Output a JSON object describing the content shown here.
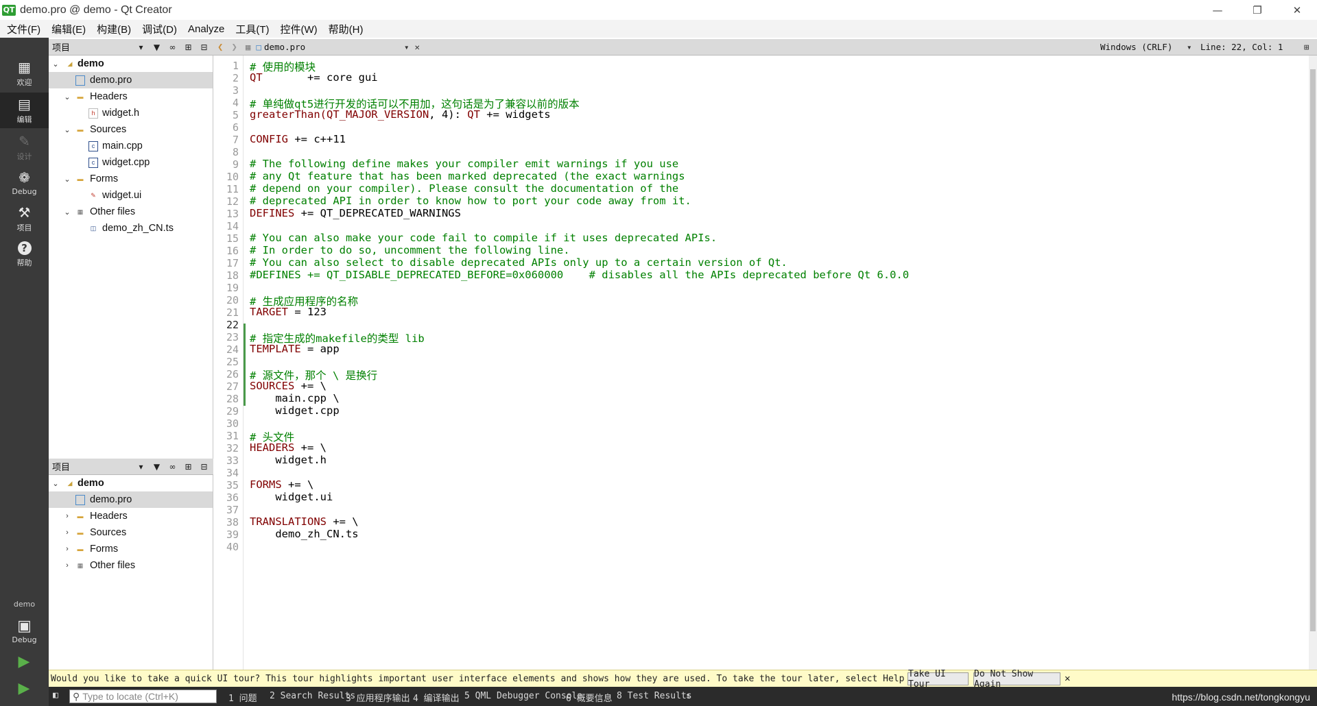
{
  "window": {
    "title": "demo.pro @ demo - Qt Creator",
    "logo": "QT"
  },
  "menu": [
    "文件(F)",
    "编辑(E)",
    "构建(B)",
    "调试(D)",
    "Analyze",
    "工具(T)",
    "控件(W)",
    "帮助(H)"
  ],
  "modes": [
    {
      "label": "欢迎",
      "icon": "grid-icon"
    },
    {
      "label": "编辑",
      "icon": "edit-icon"
    },
    {
      "label": "设计",
      "icon": "pencil-icon"
    },
    {
      "label": "Debug",
      "icon": "bug-icon"
    },
    {
      "label": "项目",
      "icon": "wrench-icon"
    },
    {
      "label": "帮助",
      "icon": "help-icon"
    }
  ],
  "kit": {
    "project": "demo",
    "mode": "Debug"
  },
  "projects_pane": {
    "title": "项目",
    "tree": [
      {
        "label": "demo",
        "level": 0,
        "expanded": true,
        "bold": true
      },
      {
        "label": "demo.pro",
        "level": 1,
        "selected": true
      },
      {
        "label": "Headers",
        "level": 1,
        "expanded": true
      },
      {
        "label": "widget.h",
        "level": 2
      },
      {
        "label": "Sources",
        "level": 1,
        "expanded": true
      },
      {
        "label": "main.cpp",
        "level": 2
      },
      {
        "label": "widget.cpp",
        "level": 2
      },
      {
        "label": "Forms",
        "level": 1,
        "expanded": true
      },
      {
        "label": "widget.ui",
        "level": 2
      },
      {
        "label": "Other files",
        "level": 1,
        "expanded": true
      },
      {
        "label": "demo_zh_CN.ts",
        "level": 2
      }
    ]
  },
  "projects_pane2": {
    "title": "项目",
    "tree": [
      {
        "label": "demo",
        "level": 0,
        "expanded": true,
        "bold": true
      },
      {
        "label": "demo.pro",
        "level": 1,
        "selected": true
      },
      {
        "label": "Headers",
        "level": 1,
        "expanded": false
      },
      {
        "label": "Sources",
        "level": 1,
        "expanded": false
      },
      {
        "label": "Forms",
        "level": 1,
        "expanded": false
      },
      {
        "label": "Other files",
        "level": 1,
        "expanded": false
      }
    ]
  },
  "editor": {
    "file": "demo.pro",
    "line_ending": "Windows (CRLF)",
    "position": "Line: 22, Col: 1",
    "current_line": 22,
    "colors": {
      "comment": "#008000",
      "keyword": "#800000",
      "text": "#000000"
    },
    "lines": [
      [
        {
          "t": "# 使用的模块",
          "c": "comment"
        }
      ],
      [
        {
          "t": "QT",
          "c": "keyword"
        },
        {
          "t": "       += core gui",
          "c": "text"
        }
      ],
      [],
      [
        {
          "t": "# 单纯做qt5进行开发的话可以不用加，这句话是为了兼容以前的版本",
          "c": "comment"
        }
      ],
      [
        {
          "t": "greaterThan(QT_MAJOR_VERSION",
          "c": "keyword"
        },
        {
          "t": ", 4): ",
          "c": "text"
        },
        {
          "t": "QT",
          "c": "keyword"
        },
        {
          "t": " += widgets",
          "c": "text"
        }
      ],
      [],
      [
        {
          "t": "CONFIG",
          "c": "keyword"
        },
        {
          "t": " += c++11",
          "c": "text"
        }
      ],
      [],
      [
        {
          "t": "# The following define makes your compiler emit warnings if you use",
          "c": "comment"
        }
      ],
      [
        {
          "t": "# any Qt feature that has been marked deprecated (the exact warnings",
          "c": "comment"
        }
      ],
      [
        {
          "t": "# depend on your compiler). Please consult the documentation of the",
          "c": "comment"
        }
      ],
      [
        {
          "t": "# deprecated API in order to know how to port your code away from it.",
          "c": "comment"
        }
      ],
      [
        {
          "t": "DEFINES",
          "c": "keyword"
        },
        {
          "t": " += QT_DEPRECATED_WARNINGS",
          "c": "text"
        }
      ],
      [],
      [
        {
          "t": "# You can also make your code fail to compile if it uses deprecated APIs.",
          "c": "comment"
        }
      ],
      [
        {
          "t": "# In order to do so, uncomment the following line.",
          "c": "comment"
        }
      ],
      [
        {
          "t": "# You can also select to disable deprecated APIs only up to a certain version of Qt.",
          "c": "comment"
        }
      ],
      [
        {
          "t": "#DEFINES += QT_DISABLE_DEPRECATED_BEFORE=0x060000    # disables all the APIs deprecated before Qt 6.0.0",
          "c": "comment"
        }
      ],
      [],
      [
        {
          "t": "# 生成应用程序的名称",
          "c": "comment"
        }
      ],
      [
        {
          "t": "TARGET",
          "c": "keyword"
        },
        {
          "t": " = 123",
          "c": "text"
        }
      ],
      [],
      [
        {
          "t": "# 指定生成的makefile的类型 lib",
          "c": "comment"
        }
      ],
      [
        {
          "t": "TEMPLATE",
          "c": "keyword"
        },
        {
          "t": " = app",
          "c": "text"
        }
      ],
      [],
      [
        {
          "t": "# 源文件，那个 \\ 是换行",
          "c": "comment"
        }
      ],
      [
        {
          "t": "SOURCES",
          "c": "keyword"
        },
        {
          "t": " += \\",
          "c": "text"
        }
      ],
      [
        {
          "t": "    main.cpp \\",
          "c": "text"
        }
      ],
      [
        {
          "t": "    widget.cpp",
          "c": "text"
        }
      ],
      [],
      [
        {
          "t": "# 头文件",
          "c": "comment"
        }
      ],
      [
        {
          "t": "HEADERS",
          "c": "keyword"
        },
        {
          "t": " += \\",
          "c": "text"
        }
      ],
      [
        {
          "t": "    widget.h",
          "c": "text"
        }
      ],
      [],
      [
        {
          "t": "FORMS",
          "c": "keyword"
        },
        {
          "t": " += \\",
          "c": "text"
        }
      ],
      [
        {
          "t": "    widget.ui",
          "c": "text"
        }
      ],
      [],
      [
        {
          "t": "TRANSLATIONS",
          "c": "keyword"
        },
        {
          "t": " += \\",
          "c": "text"
        }
      ],
      [
        {
          "t": "    demo_zh_CN.ts",
          "c": "text"
        }
      ],
      []
    ]
  },
  "infobar": {
    "message": "Would you like to take a quick UI tour? This tour highlights important user interface elements and shows how they are used. To take the tour later, select Help > UI Tour.",
    "take_tour": "Take UI Tour",
    "dont_show": "Do Not Show Again"
  },
  "status": {
    "locator_placeholder": "Type to locate (Ctrl+K)",
    "tabs": [
      "1 问题",
      "2 Search Results",
      "3 应用程序输出",
      "4 编译输出",
      "5 QML Debugger Console",
      "6 概要信息",
      "8 Test Results"
    ],
    "watermark": "https://blog.csdn.net/tongkongyu"
  }
}
